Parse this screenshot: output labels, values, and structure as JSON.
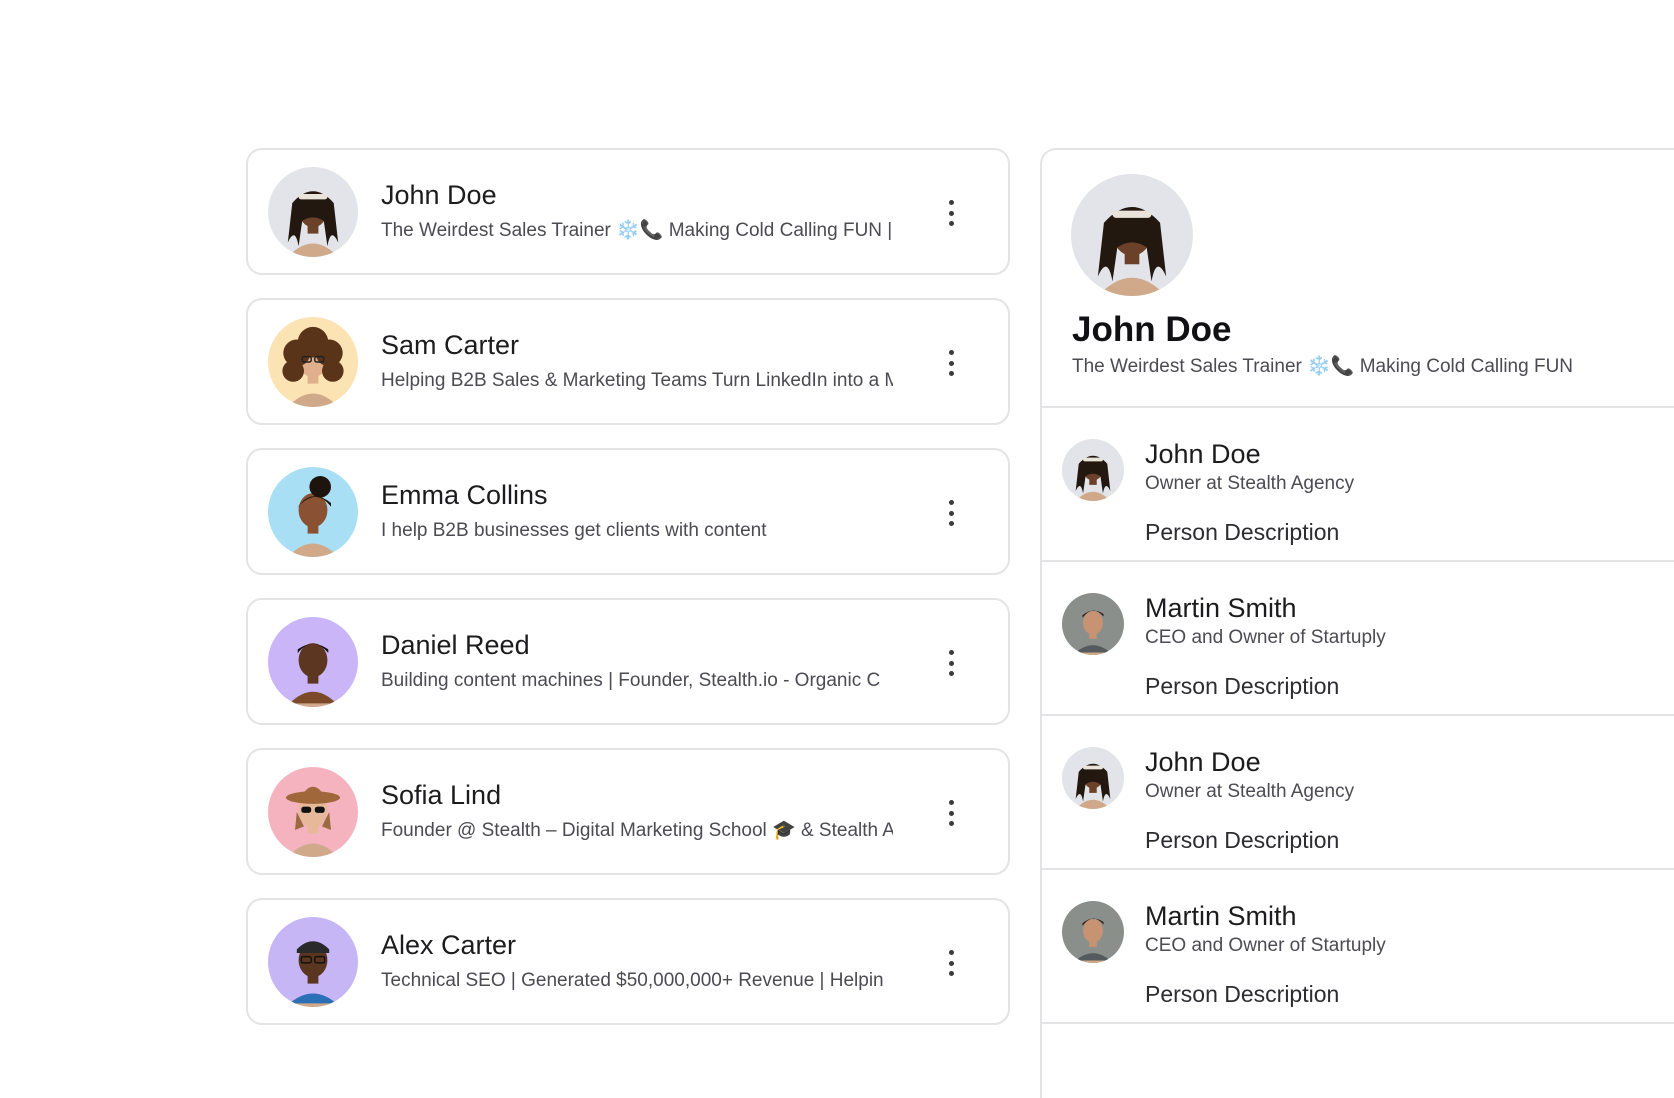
{
  "contacts": [
    {
      "name": "John Doe",
      "headline": "The Weirdest Sales Trainer ❄️📞 Making Cold Calling FUN |",
      "avatar_bg": "#e2e4ea",
      "skin": "#6b4129",
      "hair": "#23180f",
      "style": "locs",
      "icon": "person-avatar-icon"
    },
    {
      "name": "Sam Carter",
      "headline": "Helping B2B Sales & Marketing Teams Turn LinkedIn into a M",
      "avatar_bg": "#fbe3b3",
      "skin": "#e0b08c",
      "hair": "#5a3418",
      "style": "curly",
      "icon": "person-avatar-icon"
    },
    {
      "name": "Emma Collins",
      "headline": "I help B2B businesses get clients with content",
      "avatar_bg": "#a9dff5",
      "skin": "#8a5232",
      "hair": "#1f140d",
      "style": "bun",
      "icon": "person-avatar-icon"
    },
    {
      "name": "Daniel Reed",
      "headline": "Building content machines | Founder, Stealth.io - Organic C",
      "avatar_bg": "#c9b5f8",
      "skin": "#5c3620",
      "hair": "#1a120c",
      "style": "short",
      "icon": "person-avatar-icon"
    },
    {
      "name": "Sofia Lind",
      "headline": "Founder @ Stealth – Digital Marketing School 🎓 & Stealth A",
      "avatar_bg": "#f5b3c0",
      "skin": "#e7b89a",
      "hair": "#9b6a3f",
      "style": "hat",
      "icon": "person-avatar-icon"
    },
    {
      "name": "Alex Carter",
      "headline": "Technical SEO | Generated $50,000,000+ Revenue | Helpin",
      "avatar_bg": "#c7b6f5",
      "skin": "#5a3520",
      "hair": "#2a2a2a",
      "style": "cap",
      "icon": "person-avatar-icon"
    }
  ],
  "profile": {
    "name": "John Doe",
    "headline": "The Weirdest Sales Trainer ❄️📞 Making Cold Calling FUN"
  },
  "people": [
    {
      "name": "John Doe",
      "role": "Owner at Stealth Agency",
      "description": "Person Description",
      "style": "locs"
    },
    {
      "name": "Martin Smith",
      "role": "CEO and Owner of Startuply",
      "description": "Person Description",
      "style": "office"
    },
    {
      "name": "John Doe",
      "role": "Owner at Stealth Agency",
      "description": "Person Description",
      "style": "locs"
    },
    {
      "name": "Martin Smith",
      "role": "CEO and Owner of Startuply",
      "description": "Person Description",
      "style": "office"
    }
  ],
  "colors": {
    "border": "#e4e4e7",
    "text_primary": "#1c1c1e",
    "text_secondary": "#4b4b52"
  }
}
